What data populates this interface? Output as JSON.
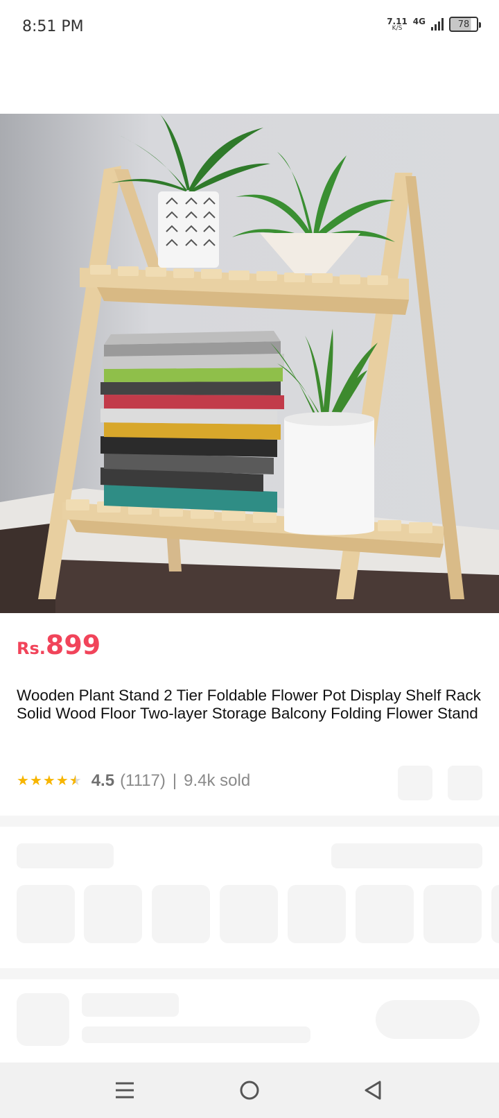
{
  "status_bar": {
    "time": "8:51 PM",
    "net_speed_value": "7.11",
    "net_speed_unit": "K/S",
    "network_type": "4G",
    "battery": "78"
  },
  "product": {
    "image_icon": "product-photo",
    "price_currency": "Rs.",
    "price_amount": "899",
    "title": "Wooden Plant Stand 2 Tier Foldable Flower Pot Display Shelf Rack Solid Wood Floor Two-layer Storage Balcony Folding Flower Stand",
    "rating": "4.5",
    "rating_count": "(1117)",
    "separator": "|",
    "sold": "9.4k sold",
    "stars": [
      "★",
      "★",
      "★",
      "★",
      "★"
    ]
  },
  "nav": {
    "menu_icon": "menu-icon",
    "home_icon": "home-circle-icon",
    "back_icon": "back-triangle-icon"
  },
  "colors": {
    "price": "#f1445a",
    "star": "#f7b500",
    "skeleton": "#f4f4f4"
  }
}
